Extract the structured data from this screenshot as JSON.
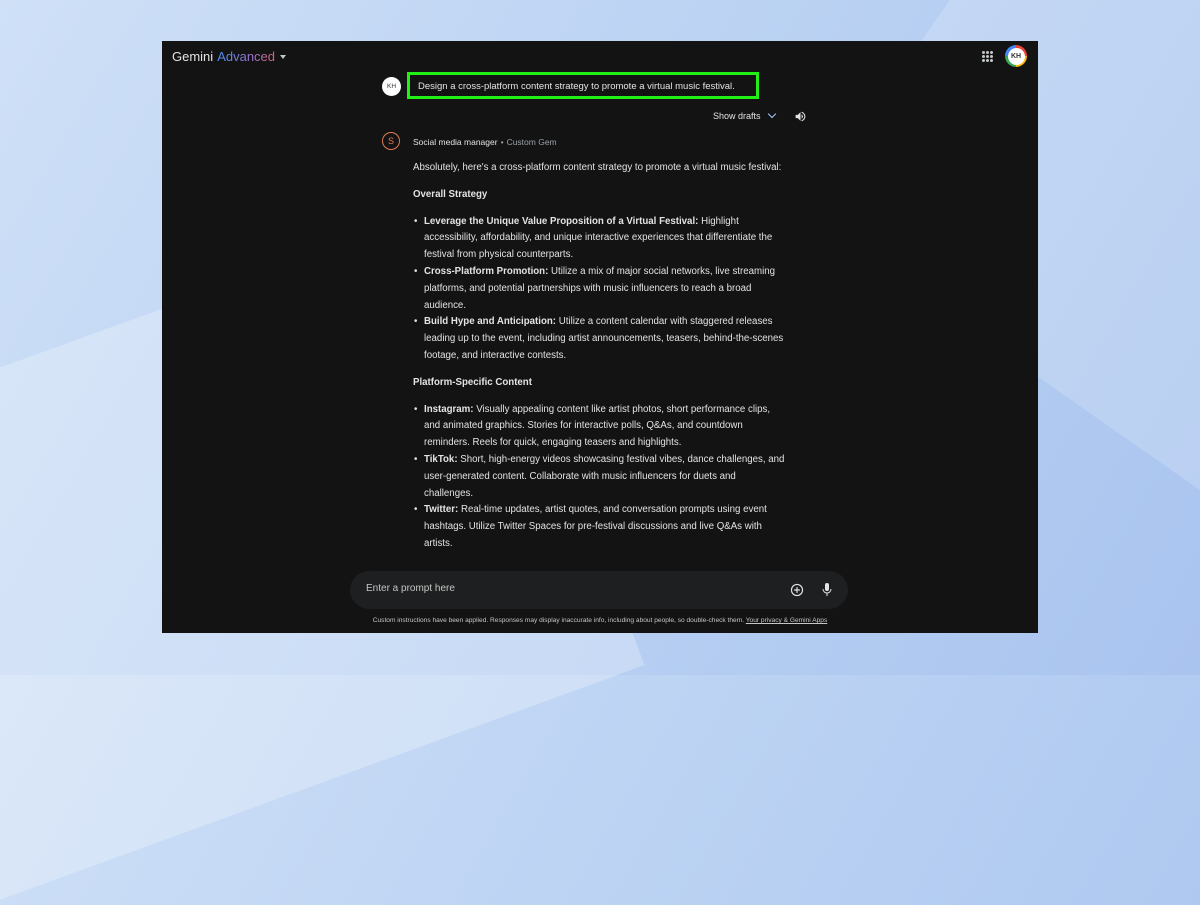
{
  "app": {
    "title": "Gemini",
    "title_suffix": "Advanced",
    "user_initials": "KH"
  },
  "prompt": {
    "text": "Design a cross-platform content strategy to promote a virtual music festival.",
    "highlight_color": "#22ef16"
  },
  "drafts": {
    "label": "Show drafts"
  },
  "gem": {
    "initial": "S",
    "name": "Social media manager",
    "type": "Custom Gem",
    "separator": "•"
  },
  "response": {
    "intro": "Absolutely, here's a cross-platform content strategy to promote a virtual music festival:",
    "sections": [
      {
        "heading": "Overall Strategy",
        "items": [
          {
            "bold": "Leverage the Unique Value Proposition of a Virtual Festival:",
            "text": " Highlight accessibility, affordability, and unique interactive experiences that differentiate the festival from physical counterparts."
          },
          {
            "bold": "Cross-Platform Promotion:",
            "text": " Utilize a mix of major social networks, live streaming platforms, and potential partnerships with music influencers to reach a broad audience."
          },
          {
            "bold": "Build Hype and Anticipation:",
            "text": " Utilize a content calendar with staggered releases leading up to the event, including artist announcements, teasers, behind-the-scenes footage, and interactive contests."
          }
        ]
      },
      {
        "heading": "Platform-Specific Content",
        "items": [
          {
            "bold": "Instagram:",
            "text": " Visually appealing content like artist photos, short performance clips, and animated graphics. Stories for interactive polls, Q&As, and countdown reminders. Reels for quick, engaging teasers and highlights."
          },
          {
            "bold": "TikTok:",
            "text": " Short, high-energy videos showcasing festival vibes, dance challenges, and user-generated content. Collaborate with music influencers for duets and challenges."
          },
          {
            "bold": "Twitter:",
            "text": " Real-time updates, artist quotes, and conversation prompts using event hashtags. Utilize Twitter Spaces for pre-festival discussions and live Q&As with artists."
          }
        ]
      }
    ]
  },
  "input": {
    "placeholder": "Enter a prompt here"
  },
  "footer": {
    "text": "Custom instructions have been applied. Responses may display inaccurate info, including about people, so double-check them.",
    "link": "Your privacy & Gemini Apps"
  },
  "icons": [
    "apps-icon",
    "avatar",
    "chevron-down-icon",
    "speaker-icon",
    "add-icon",
    "mic-icon"
  ]
}
